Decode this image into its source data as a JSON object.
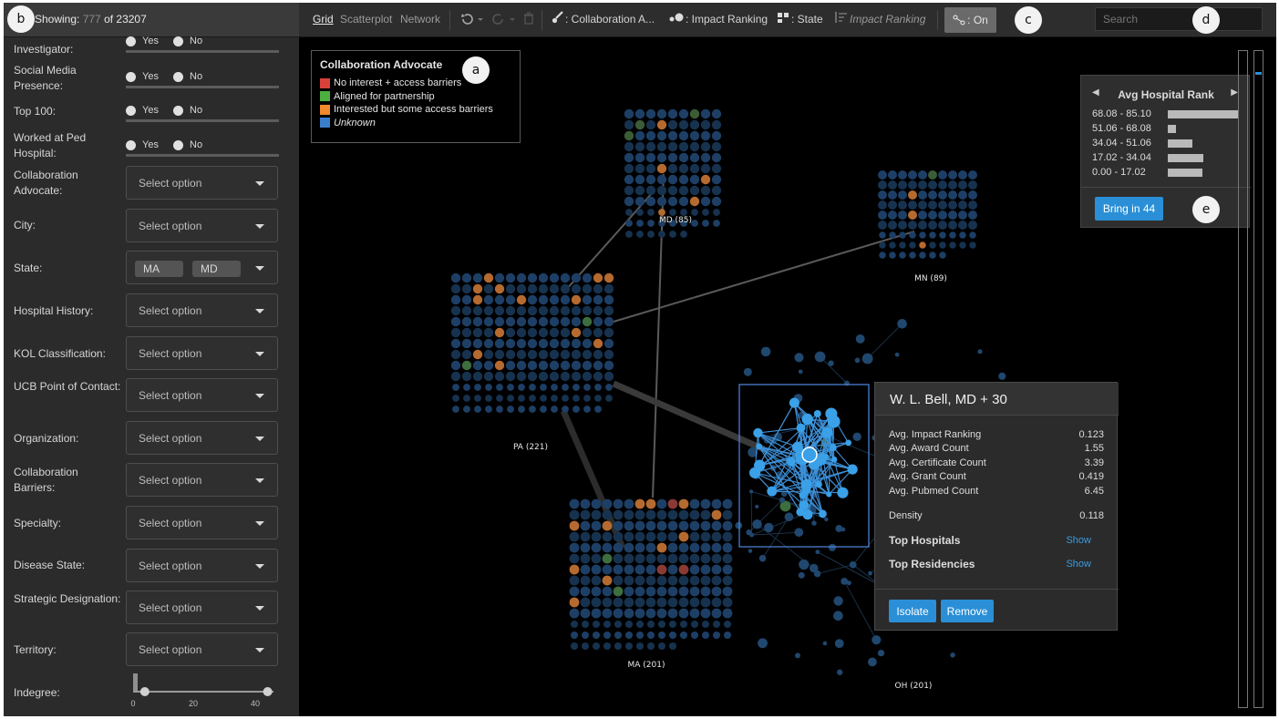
{
  "markers": {
    "a": "a",
    "b": "b",
    "c": "c",
    "d": "d",
    "e": "e"
  },
  "sidebar": {
    "showing_prefix": "Showing: ",
    "showing_count": "777",
    "showing_suffix": " of 23207",
    "radio_filters": [
      {
        "label": "Investigator:",
        "yes": "Yes",
        "no": "No"
      },
      {
        "label": "Social Media Presence:",
        "yes": "Yes",
        "no": "No"
      },
      {
        "label": "Top 100:",
        "yes": "Yes",
        "no": "No"
      },
      {
        "label": "Worked at Ped Hospital:",
        "yes": "Yes",
        "no": "No"
      }
    ],
    "select_filters": [
      {
        "label": "Collaboration Advocate:",
        "placeholder": "Select option"
      },
      {
        "label": "City:",
        "placeholder": "Select option"
      },
      {
        "label": "State:",
        "chips": [
          "MA",
          "MD"
        ]
      },
      {
        "label": "Hospital History:",
        "placeholder": "Select option"
      },
      {
        "label": "KOL Classification:",
        "placeholder": "Select option"
      },
      {
        "label": "UCB Point of Contact:",
        "placeholder": "Select option"
      },
      {
        "label": "Organization:",
        "placeholder": "Select option"
      },
      {
        "label": "Collaboration Barriers:",
        "placeholder": "Select option"
      },
      {
        "label": "Specialty:",
        "placeholder": "Select option"
      },
      {
        "label": "Disease State:",
        "placeholder": "Select option"
      },
      {
        "label": "Strategic Designation:",
        "placeholder": "Select option"
      },
      {
        "label": "Territory:",
        "placeholder": "Select option"
      }
    ],
    "indegree": {
      "label": "Indegree:",
      "ticks": [
        "0",
        "20",
        "40"
      ],
      "range": [
        4,
        46
      ],
      "max": 48
    }
  },
  "toolbar": {
    "views": [
      "Grid",
      "Scatterplot",
      "Network"
    ],
    "active_view": "Grid",
    "color_by": ": Collaboration A...",
    "size_by": ": Impact Ranking",
    "group_by": ": State",
    "sort_by": "Impact Ranking",
    "toggle": ": On",
    "search_placeholder": "Search"
  },
  "legend": {
    "title": "Collaboration Advocate",
    "items": [
      {
        "label": "No interest + access barriers",
        "color": "#d9413a",
        "italic": false
      },
      {
        "label": "Aligned for partnership",
        "color": "#4caf3f",
        "italic": false
      },
      {
        "label": "Interested but some access barriers",
        "color": "#f08a2c",
        "italic": false
      },
      {
        "label": "Unknown",
        "color": "#3b7fcc",
        "italic": true
      }
    ]
  },
  "rank_panel": {
    "title": "Avg Hospital Rank",
    "rows": [
      {
        "range": "68.08 - 85.10",
        "fraction": 1.0
      },
      {
        "range": "51.06 - 68.08",
        "fraction": 0.12
      },
      {
        "range": "34.04 - 51.06",
        "fraction": 0.35
      },
      {
        "range": "17.02 - 34.04",
        "fraction": 0.5
      },
      {
        "range": "0.00 - 17.02",
        "fraction": 0.49
      }
    ],
    "button": "Bring in 44"
  },
  "clusters": [
    {
      "label": "MD (85)"
    },
    {
      "label": "MN (89)"
    },
    {
      "label": "PA (221)"
    },
    {
      "label": "MA (201)"
    },
    {
      "label": "OH (201)"
    }
  ],
  "detail": {
    "title": "W. L. Bell, MD + 30",
    "stats": [
      {
        "label": "Avg. Impact Ranking",
        "value": "0.123"
      },
      {
        "label": "Avg. Award Count",
        "value": "1.55"
      },
      {
        "label": "Avg. Certificate Count",
        "value": "3.39"
      },
      {
        "label": "Avg. Grant Count",
        "value": "0.419"
      },
      {
        "label": "Avg. Pubmed Count",
        "value": "6.45"
      }
    ],
    "density_label": "Density",
    "density_value": "0.118",
    "top_hospitals": "Top Hospitals",
    "top_residencies": "Top Residencies",
    "show": "Show",
    "isolate": "Isolate",
    "remove": "Remove"
  },
  "colors": {
    "node": "#1d3f66",
    "node_dim": "#16324f",
    "highlight": "#3aa0e8",
    "accent": "#2a8fd6"
  }
}
